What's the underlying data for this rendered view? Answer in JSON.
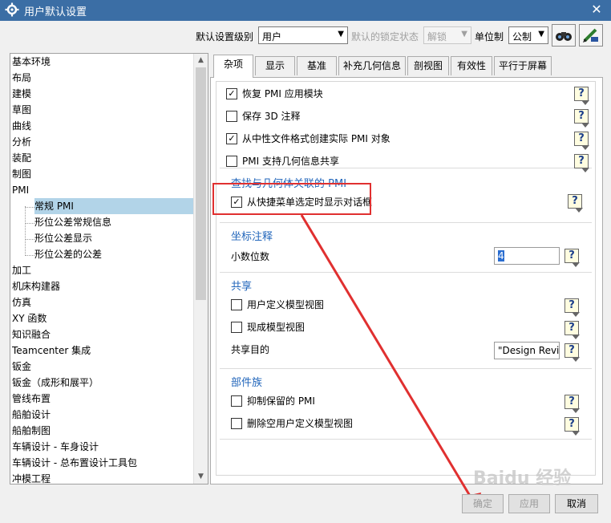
{
  "window": {
    "title": "用户默认设置",
    "icon": "gear-icon",
    "close_label": "✕"
  },
  "toolbar": {
    "level_label": "默认设置级别",
    "level_value": "用户",
    "lock_label": "默认的锁定状态",
    "lock_value": "解锁",
    "unit_label": "单位制",
    "unit_value": "公制",
    "icon_1": "binoculars-icon",
    "icon_2": "pen-settings-icon"
  },
  "sidebar": {
    "items": [
      {
        "label": "基本环境"
      },
      {
        "label": "布局"
      },
      {
        "label": "建模"
      },
      {
        "label": "草图"
      },
      {
        "label": "曲线"
      },
      {
        "label": "分析"
      },
      {
        "label": "装配"
      },
      {
        "label": "制图"
      },
      {
        "label": "PMI"
      },
      {
        "label": "常规 PMI"
      },
      {
        "label": "形位公差常规信息"
      },
      {
        "label": "形位公差显示"
      },
      {
        "label": "形位公差的公差"
      },
      {
        "label": "加工"
      },
      {
        "label": "机床构建器"
      },
      {
        "label": "仿真"
      },
      {
        "label": "XY 函数"
      },
      {
        "label": "知识融合"
      },
      {
        "label": "Teamcenter 集成"
      },
      {
        "label": "钣金"
      },
      {
        "label": "钣金（成形和展平）"
      },
      {
        "label": "管线布置"
      },
      {
        "label": "船舶设计"
      },
      {
        "label": "船舶制图"
      },
      {
        "label": "车辆设计 - 车身设计"
      },
      {
        "label": "车辆设计 - 总布置设计工具包"
      },
      {
        "label": "冲模工程"
      }
    ],
    "selected": "常规 PMI"
  },
  "tabs": [
    {
      "label": "杂项"
    },
    {
      "label": "显示"
    },
    {
      "label": "基准"
    },
    {
      "label": "补充几何信息"
    },
    {
      "label": "剖视图"
    },
    {
      "label": "有效性"
    },
    {
      "label": "平行于屏幕"
    }
  ],
  "misc": {
    "options": [
      {
        "label": "恢复 PMI 应用模块",
        "checked": true
      },
      {
        "label": "保存 3D 注释",
        "checked": false
      },
      {
        "label": "从中性文件格式创建实际 PMI 对象",
        "checked": true
      },
      {
        "label": "PMI 支持几何信息共享",
        "checked": false
      }
    ],
    "find_group": {
      "title": "查找与几何体关联的 PMI",
      "option": {
        "label": "从快捷菜单选定时显示对话框",
        "checked": true
      }
    },
    "coord_group": {
      "title": "坐标注释",
      "decimal_label": "小数位数",
      "decimal_value": "4"
    },
    "share_group": {
      "title": "共享",
      "options": [
        {
          "label": "用户定义模型视图",
          "checked": false
        },
        {
          "label": "现成模型视图",
          "checked": false
        }
      ],
      "target_label": "共享目的",
      "target_value": "\"Design Revi"
    },
    "family_group": {
      "title": "部件族",
      "options": [
        {
          "label": "抑制保留的 PMI",
          "checked": false
        },
        {
          "label": "删除空用户定义模型视图",
          "checked": false
        }
      ]
    },
    "help_glyph": "?"
  },
  "footer": {
    "ok": "确定",
    "apply": "应用",
    "cancel": "取消"
  },
  "watermark": "Baidu 经验",
  "colors": {
    "titlebar": "#3b6ea5",
    "selected": "#b2d4e8",
    "group_title": "#2266bb",
    "highlight": "#e03030"
  }
}
